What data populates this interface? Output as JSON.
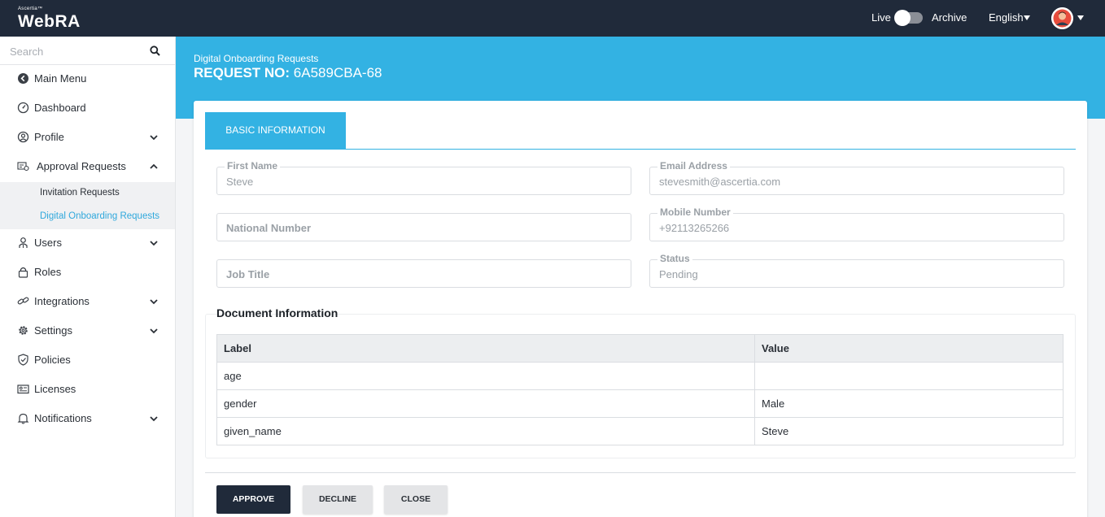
{
  "brand": {
    "small": "Ascertia™",
    "name": "WebRA"
  },
  "topbar": {
    "live_label": "Live",
    "archive_label": "Archive",
    "language": "English"
  },
  "sidebar": {
    "search_placeholder": "Search",
    "items": [
      {
        "label": "Main Menu",
        "icon": "back-circle-icon"
      },
      {
        "label": "Dashboard",
        "icon": "dashboard-icon"
      },
      {
        "label": "Profile",
        "icon": "user-circle-icon"
      },
      {
        "label": "Approval Requests",
        "icon": "approval-icon"
      },
      {
        "label": "Users",
        "icon": "users-icon"
      },
      {
        "label": "Roles",
        "icon": "lock-icon"
      },
      {
        "label": "Integrations",
        "icon": "link-icon"
      },
      {
        "label": "Settings",
        "icon": "gear-icon"
      },
      {
        "label": "Policies",
        "icon": "shield-icon"
      },
      {
        "label": "Licenses",
        "icon": "license-icon"
      },
      {
        "label": "Notifications",
        "icon": "bell-icon"
      }
    ],
    "sub_items": [
      {
        "label": "Invitation Requests"
      },
      {
        "label": "Digital Onboarding Requests"
      }
    ]
  },
  "header": {
    "subtitle": "Digital Onboarding Requests",
    "title_prefix": "REQUEST NO:",
    "request_no": "6A589CBA-68"
  },
  "tab": {
    "label": "BASIC INFORMATION"
  },
  "form": {
    "first_name": {
      "label": "First Name",
      "value": "Steve"
    },
    "email": {
      "label": "Email Address",
      "value": "stevesmith@ascertia.com"
    },
    "national_number": {
      "placeholder": "National Number"
    },
    "mobile": {
      "label": "Mobile Number",
      "value": "+92113265266"
    },
    "job_title": {
      "placeholder": "Job Title"
    },
    "status": {
      "label": "Status",
      "value": "Pending"
    }
  },
  "documents": {
    "title": "Document Information",
    "headers": [
      "Label",
      "Value"
    ],
    "rows": [
      [
        "age",
        ""
      ],
      [
        "gender",
        "Male"
      ],
      [
        "given_name",
        "Steve"
      ]
    ]
  },
  "actions": {
    "approve": "APPROVE",
    "decline": "DECLINE",
    "close": "CLOSE"
  },
  "colors": {
    "topbar": "#202a3a",
    "accent": "#33b2e3",
    "active_link": "#2fa8dc"
  }
}
